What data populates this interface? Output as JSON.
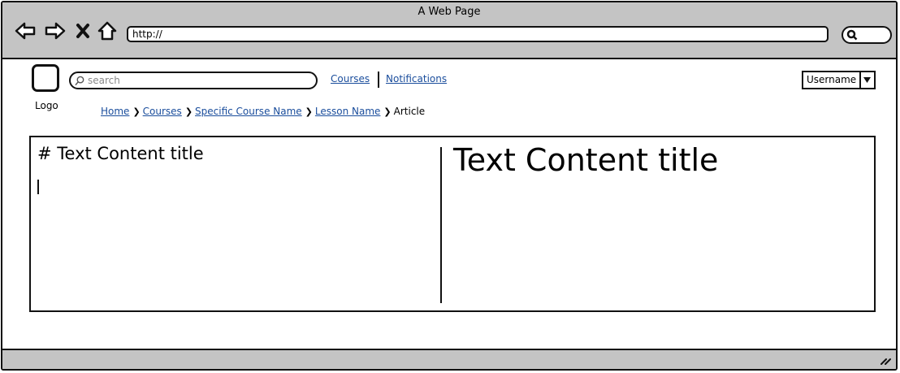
{
  "window": {
    "title": "A Web Page"
  },
  "browser": {
    "url": "http://"
  },
  "logo": {
    "label": "Logo"
  },
  "search": {
    "placeholder": "search"
  },
  "nav": {
    "courses": "Courses",
    "notifications": "Notifications"
  },
  "user": {
    "name": "Username"
  },
  "breadcrumb": {
    "items": [
      "Home",
      "Courses",
      "Specific Course Name",
      "Lesson Name"
    ],
    "current": "Article"
  },
  "editor": {
    "markdown_title": "# Text Content title"
  },
  "preview": {
    "title": "Text Content title"
  },
  "colors": {
    "link": "#1a4d9c",
    "chrome": "#c4c4c4"
  }
}
